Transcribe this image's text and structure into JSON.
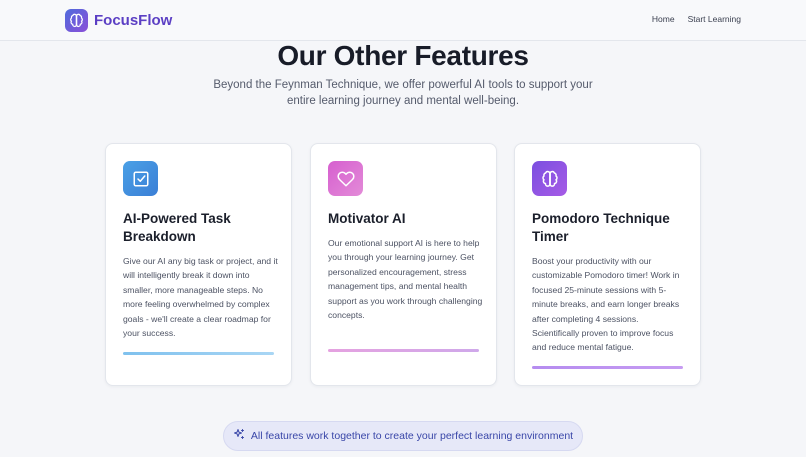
{
  "nav": {
    "brand": "FocusFlow",
    "logo_icon": "brain-icon",
    "links": [
      "Home",
      "Start Learning"
    ]
  },
  "section": {
    "title": "Our Other Features",
    "subtitle": "Beyond the Feynman Technique, we offer powerful AI tools to support your entire learning journey and mental well-being."
  },
  "features": [
    {
      "icon": "checkbox-icon",
      "title": "AI-Powered Task Breakdown",
      "description": "Give our AI any big task or project, and it will intelligently break it down into smaller, more manageable steps. No more feeling overwhelmed by complex goals - we'll create a clear roadmap for your success.",
      "accent": "#3b7fd6"
    },
    {
      "icon": "heart-icon",
      "title": "Motivator AI",
      "description": "Our emotional support AI is here to help you through your learning journey. Get personalized encouragement, stress management tips, and mental health support as you work through challenging concepts.",
      "accent": "#d65fcf"
    },
    {
      "icon": "brain-icon",
      "title": "Pomodoro Technique Timer",
      "description": "Boost your productivity with our customizable Pomodoro timer! Work in focused 25-minute sessions with 5-minute breaks, and earn longer breaks after completing 4 sessions. Scientifically proven to improve focus and reduce mental fatigue.",
      "accent": "#7b4fe0"
    }
  ],
  "footer_pill": {
    "icon": "sparkles-icon",
    "text": "All features work together to create your perfect learning environment"
  },
  "colors": {
    "brand": "#5b3fc4",
    "background": "#f5f6f9",
    "pill_text": "#3946a8"
  }
}
